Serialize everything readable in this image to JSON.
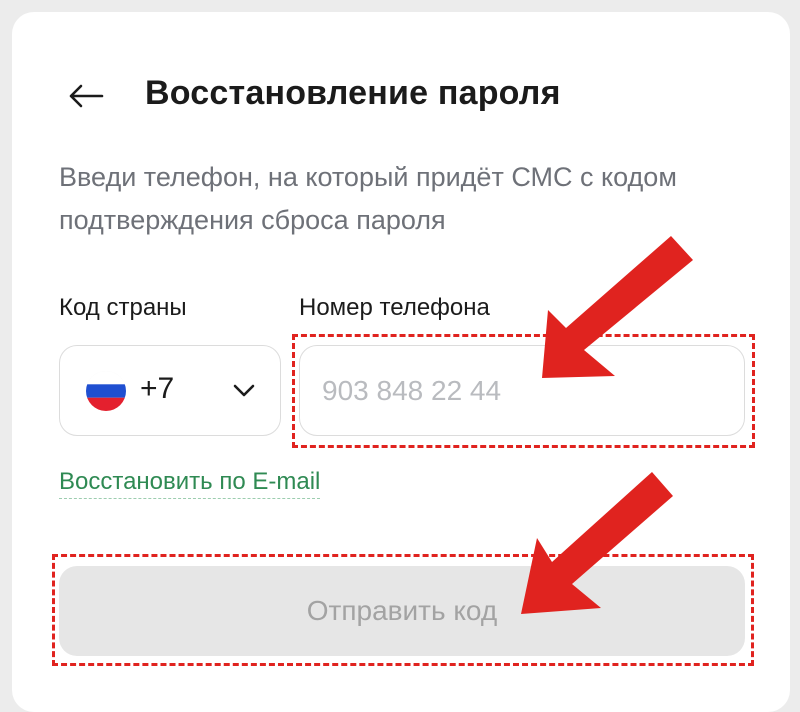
{
  "header": {
    "title": "Восстановление пароля",
    "back_icon": "arrow-left-icon"
  },
  "description": "Введи телефон, на который придёт СМС с кодом подтверждения сброса пароля",
  "form": {
    "country_label": "Код страны",
    "country_code": "+7",
    "country_flag": "russia-flag-icon",
    "phone_label": "Номер телефона",
    "phone_placeholder": "903 848 22 44",
    "phone_value": ""
  },
  "links": {
    "restore_by_email": "Восстановить по E-mail"
  },
  "actions": {
    "send_code": "Отправить код"
  },
  "annotations": {
    "color": "#e0231f",
    "targets": [
      "phone-input",
      "send-code-button"
    ]
  },
  "colors": {
    "link": "#2f8a53",
    "button_disabled_bg": "#e6e6e6",
    "button_disabled_text": "#a3a3a3"
  }
}
